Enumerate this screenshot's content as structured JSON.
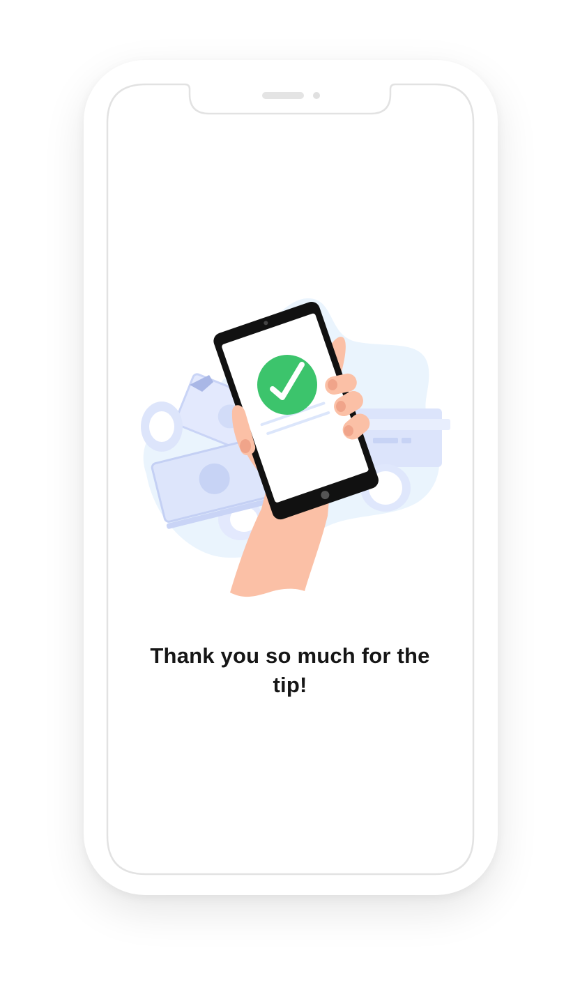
{
  "screen": {
    "message": "Thank you so much for the tip!"
  },
  "illustration": {
    "name": "payment-success-illustration",
    "status_icon": "check-circle-icon",
    "colors": {
      "success": "#3CC46C",
      "skin": "#FBC0A6",
      "skin_shade": "#F0A48A",
      "blob": "#EAF4FD",
      "money": "#DCE4FB",
      "money_dark": "#C7D3F5",
      "device": "#111111"
    }
  },
  "device": {
    "frame_color": "#E2E2E2",
    "speaker": "speaker-grille",
    "camera": "front-camera"
  }
}
